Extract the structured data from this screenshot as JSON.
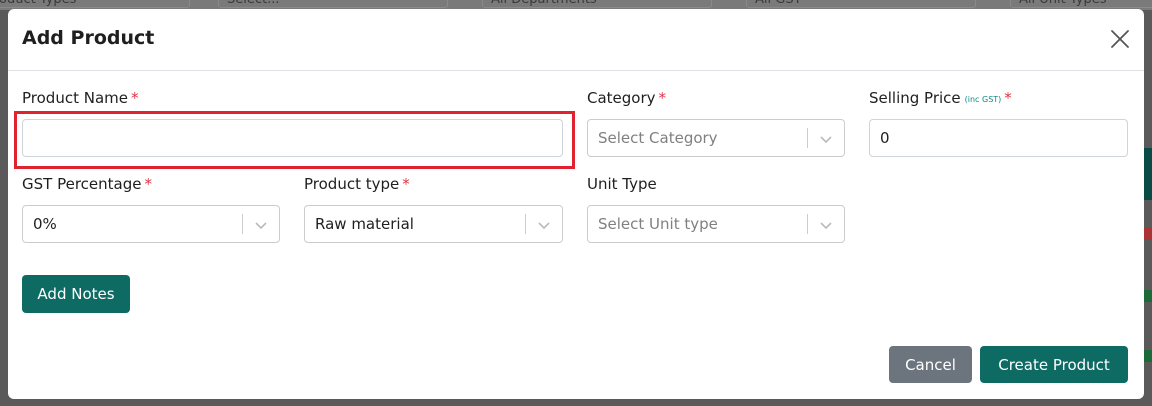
{
  "background": {
    "filters": [
      {
        "label": "oduct Types"
      },
      {
        "label": "Select..."
      },
      {
        "label": "All Departments"
      },
      {
        "label": "All GST"
      },
      {
        "label": "All Unit Types"
      }
    ]
  },
  "modal": {
    "title": "Add Product",
    "close_icon": "close-icon",
    "fields": {
      "product_name": {
        "label": "Product Name",
        "required": "*",
        "value": "",
        "placeholder": ""
      },
      "category": {
        "label": "Category",
        "required": "*",
        "placeholder": "Select Category"
      },
      "selling_price": {
        "label": "Selling Price",
        "sub_label": "(inc GST)",
        "required": "*",
        "value": "0"
      },
      "gst_percentage": {
        "label": "GST Percentage",
        "required": "*",
        "value": "0%"
      },
      "product_type": {
        "label": "Product type",
        "required": "*",
        "value": "Raw material"
      },
      "unit_type": {
        "label": "Unit Type",
        "placeholder": "Select Unit type"
      }
    },
    "add_notes_label": "Add Notes",
    "cancel_label": "Cancel",
    "create_label": "Create Product"
  },
  "colors": {
    "primary": "#0d6b64",
    "secondary": "#6c757d",
    "required": "#dc3545",
    "highlight": "#e0242f"
  }
}
